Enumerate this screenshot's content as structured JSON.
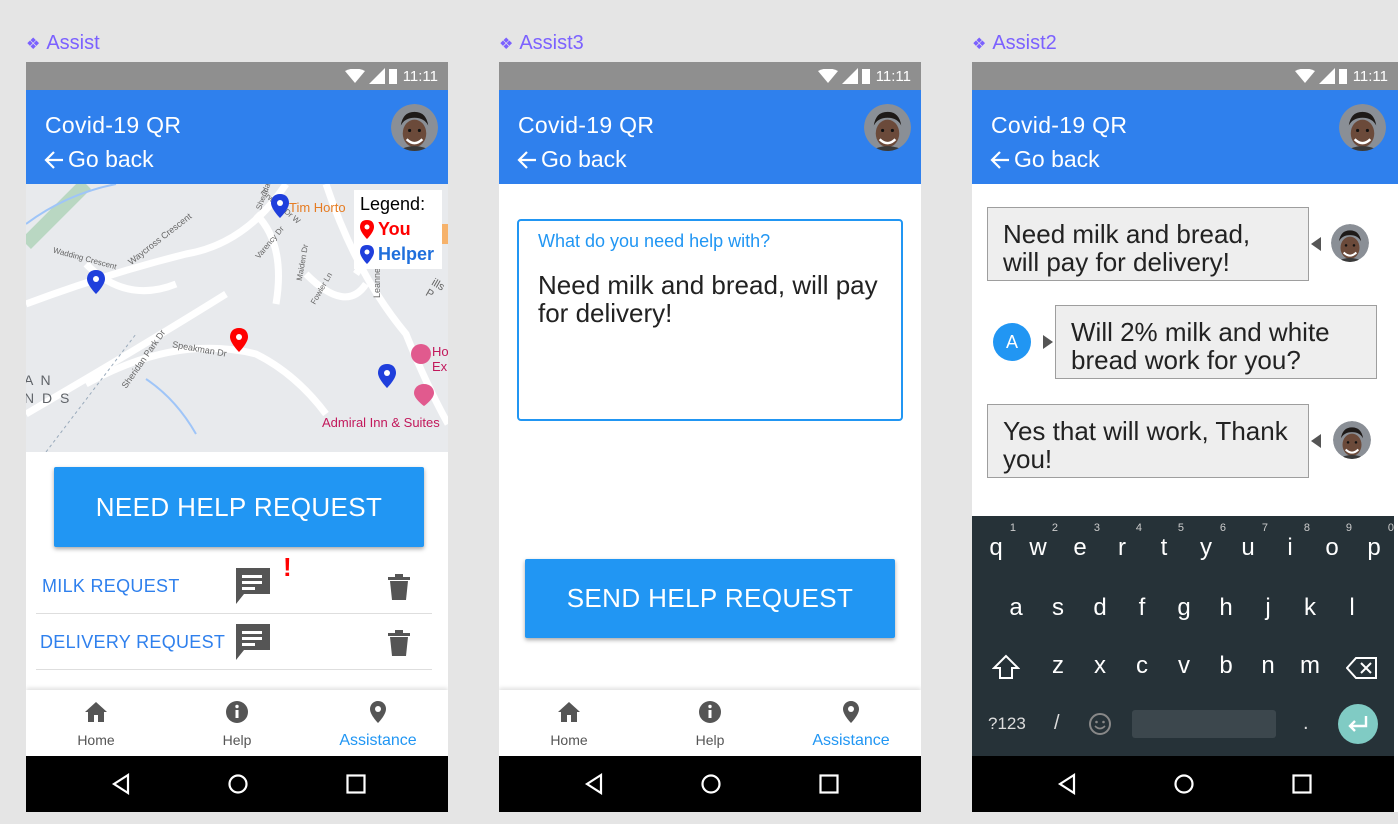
{
  "frames": [
    {
      "label": "Assist"
    },
    {
      "label": "Assist3"
    },
    {
      "label": "Assist2"
    }
  ],
  "statusbar": {
    "time": "11:11"
  },
  "appbar": {
    "title": "Covid-19 QR",
    "back_label": "Go back"
  },
  "map": {
    "legend_title": "Legend:",
    "legend_you": "You",
    "legend_helper": "Helper",
    "place_tim": "Tim Horto",
    "place_admiral": "Admiral Inn & Suites",
    "place_ho": "Ho",
    "place_ex": "Ex",
    "street_waycross": "Waycross Crescent",
    "street_speakman": "Speakman Dr",
    "street_sheridan_park": "Sheridan Park Dr",
    "street_wadding": "Wadding Crescent",
    "street_varency": "Varency Dr",
    "street_fowler": "Fowler Ln",
    "street_maiden": "Maiden Dr",
    "street_sheridan": "Sheridan",
    "street_firwood": "Firwood Dr W",
    "street_leanne": "Leanne",
    "street_mills": "ills P",
    "area_an": "A N",
    "area_nds": "N D S"
  },
  "screen1": {
    "need_help_button": "NEED HELP REQUEST",
    "requests": [
      {
        "label": "MILK REQUEST",
        "alert": "!"
      },
      {
        "label": "DELIVERY REQUEST",
        "alert": ""
      }
    ]
  },
  "screen2": {
    "placeholder": "What do you need help with?",
    "value": "Need milk and bread, will pay for delivery!",
    "send_button": "SEND HELP REQUEST"
  },
  "screen3": {
    "messages": [
      {
        "text": "Need milk and bread, will pay for delivery!",
        "from": "user"
      },
      {
        "text": "Will 2% milk and white bread work for you?",
        "from": "helper",
        "initial": "A"
      },
      {
        "text": "Yes that will work, Thank you!",
        "from": "user"
      }
    ],
    "keyboard": {
      "row1": [
        "q",
        "w",
        "e",
        "r",
        "t",
        "y",
        "u",
        "i",
        "o",
        "p"
      ],
      "row1_nums": [
        "1",
        "2",
        "3",
        "4",
        "5",
        "6",
        "7",
        "8",
        "9",
        "0"
      ],
      "row2": [
        "a",
        "s",
        "d",
        "f",
        "g",
        "h",
        "j",
        "k",
        "l"
      ],
      "row3": [
        "z",
        "x",
        "c",
        "v",
        "b",
        "n",
        "m"
      ],
      "symbols_key": "?123",
      "slash_key": "/",
      "period_key": "."
    }
  },
  "bottomnav": {
    "home": "Home",
    "help": "Help",
    "assistance": "Assistance"
  },
  "colors": {
    "primary": "#2f80ed",
    "button": "#2196f3",
    "alert": "#ff0000",
    "frame_label": "#7b61ff"
  }
}
